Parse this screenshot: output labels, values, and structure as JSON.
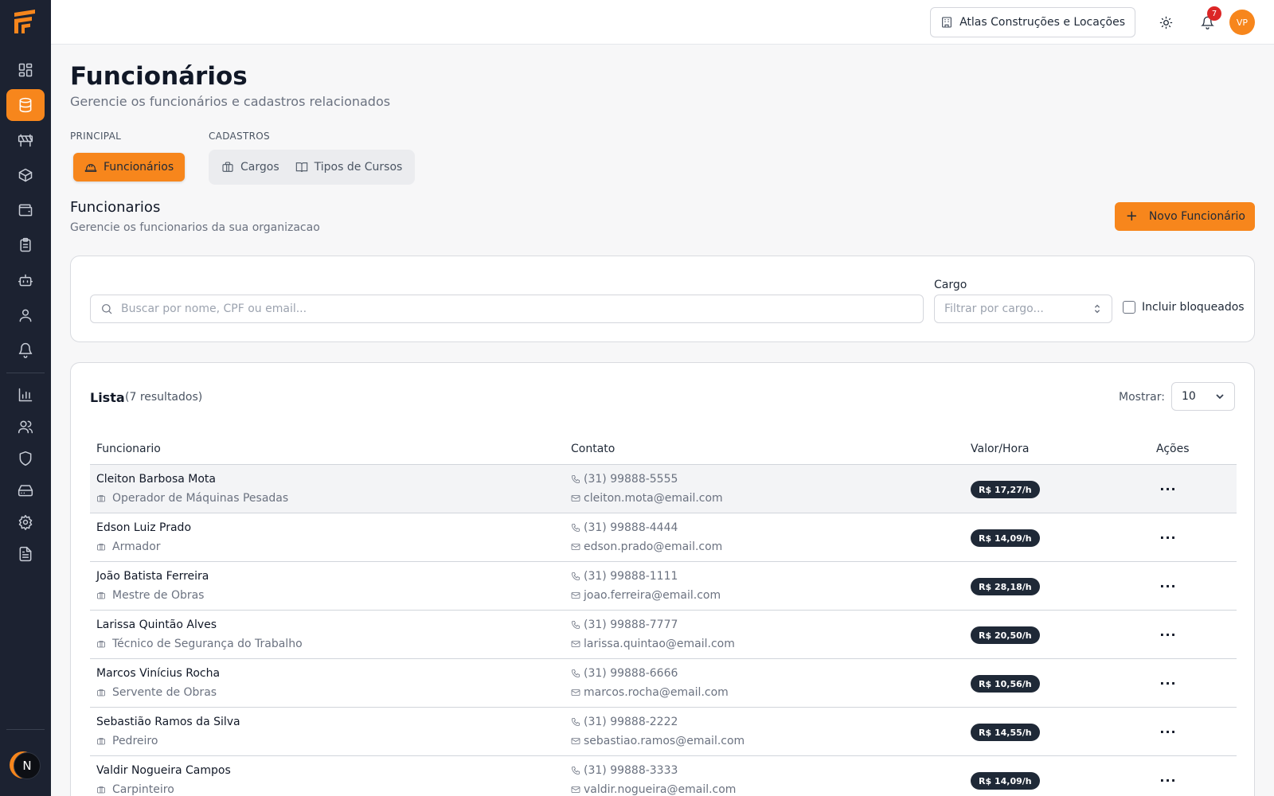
{
  "topbar": {
    "organization": "Atlas Construções e Locações",
    "notifications_count": "7",
    "avatar_initials": "VP"
  },
  "sidebar": {
    "items": [
      {
        "icon": "dashboard-icon",
        "active": false
      },
      {
        "icon": "database-icon",
        "active": true
      },
      {
        "icon": "barrier-icon",
        "active": false
      },
      {
        "icon": "package-icon",
        "active": false
      },
      {
        "icon": "wallet-icon",
        "active": false
      },
      {
        "icon": "clipboard-icon",
        "active": false
      },
      {
        "icon": "bot-icon",
        "active": false
      },
      {
        "icon": "user-icon",
        "active": false
      },
      {
        "icon": "bell-icon",
        "active": false
      },
      {
        "icon": "bar-chart-icon",
        "active": false
      },
      {
        "icon": "users-icon",
        "active": false
      },
      {
        "icon": "shield-icon",
        "active": false
      },
      {
        "icon": "hard-drive-icon",
        "active": false
      },
      {
        "icon": "settings-icon",
        "active": false
      },
      {
        "icon": "file-text-icon",
        "active": false
      }
    ],
    "user_initial": "N"
  },
  "page": {
    "title": "Funcionários",
    "subtitle": "Gerencie os funcionários e cadastros relacionados"
  },
  "tabs": {
    "principal_label": "PRINCIPAL",
    "cadastros_label": "CADASTROS",
    "funcionarios": "Funcionários",
    "cargos": "Cargos",
    "tipos_cursos": "Tipos de Cursos"
  },
  "section": {
    "title": "Funcionarios",
    "subtitle": "Gerencie os funcionarios da sua organizacao",
    "new_button": "Novo Funcionário"
  },
  "filters": {
    "search_placeholder": "Buscar por nome, CPF ou email...",
    "cargo_label": "Cargo",
    "cargo_placeholder": "Filtrar por cargo...",
    "include_blocked": "Incluir bloqueados"
  },
  "list": {
    "title": "Lista",
    "count": "(7 resultados)",
    "show_label": "Mostrar:",
    "show_value": "10",
    "columns": {
      "employee": "Funcionario",
      "contact": "Contato",
      "rate": "Valor/Hora",
      "actions": "Ações"
    }
  },
  "employees": [
    {
      "name": "Cleiton Barbosa Mota",
      "role": "Operador de Máquinas Pesadas",
      "phone": "(31) 99888-5555",
      "email": "cleiton.mota@email.com",
      "rate": "R$ 17,27/h"
    },
    {
      "name": "Edson Luiz Prado",
      "role": "Armador",
      "phone": "(31) 99888-4444",
      "email": "edson.prado@email.com",
      "rate": "R$ 14,09/h"
    },
    {
      "name": "João Batista Ferreira",
      "role": "Mestre de Obras",
      "phone": "(31) 99888-1111",
      "email": "joao.ferreira@email.com",
      "rate": "R$ 28,18/h"
    },
    {
      "name": "Larissa Quintão Alves",
      "role": "Técnico de Segurança do Trabalho",
      "phone": "(31) 99888-7777",
      "email": "larissa.quintao@email.com",
      "rate": "R$ 20,50/h"
    },
    {
      "name": "Marcos Vinícius Rocha",
      "role": "Servente de Obras",
      "phone": "(31) 99888-6666",
      "email": "marcos.rocha@email.com",
      "rate": "R$ 10,56/h"
    },
    {
      "name": "Sebastião Ramos da Silva",
      "role": "Pedreiro",
      "phone": "(31) 99888-2222",
      "email": "sebastiao.ramos@email.com",
      "rate": "R$ 14,55/h"
    },
    {
      "name": "Valdir Nogueira Campos",
      "role": "Carpinteiro",
      "phone": "(31) 99888-3333",
      "email": "valdir.nogueira@email.com",
      "rate": "R$ 14,09/h"
    }
  ],
  "colors": {
    "accent": "#f7861c",
    "sidebar": "#1c2231",
    "badge_dark": "#1f2937"
  }
}
